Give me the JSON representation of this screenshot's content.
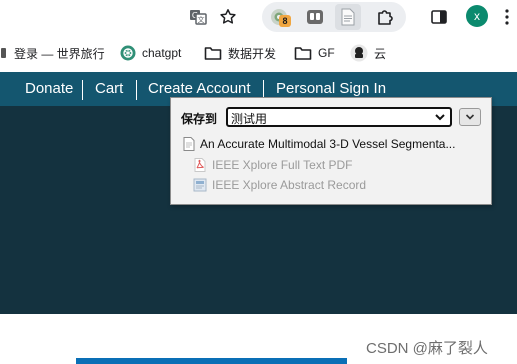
{
  "toolbar": {
    "profile_initial": "x",
    "extension_badge": "8",
    "icons": [
      "translate-icon",
      "bookmark-star-icon",
      "extension-colorful-icon",
      "extension-grid-icon",
      "document-icon",
      "puzzle-icon",
      "sidebar-icon",
      "profile-avatar",
      "more-menu-icon"
    ]
  },
  "bookmarks": {
    "items": [
      {
        "label": "登录 — 世界旅行",
        "icon": "bookmark-favicon"
      },
      {
        "label": "chatgpt",
        "icon": "openai-icon"
      },
      {
        "label": "数据开发",
        "icon": "folder-icon"
      },
      {
        "label": "GF",
        "icon": "folder-icon"
      },
      {
        "label": "云",
        "icon": "cloud-favicon"
      }
    ]
  },
  "site": {
    "nav": [
      "Donate",
      "Cart",
      "Create Account",
      "Personal Sign In"
    ],
    "colors": {
      "nav_bg": "#14566f",
      "hero_bg": "#14323f"
    }
  },
  "popup": {
    "save_label": "保存到",
    "collection": "测试用",
    "main_item": "An Accurate Multimodal 3-D Vessel Segmenta...",
    "sub_items": [
      {
        "label": "IEEE Xplore Full Text PDF",
        "icon": "pdf-icon"
      },
      {
        "label": "IEEE Xplore Abstract Record",
        "icon": "web-page-icon"
      }
    ]
  },
  "watermark": "CSDN @麻了裂人"
}
